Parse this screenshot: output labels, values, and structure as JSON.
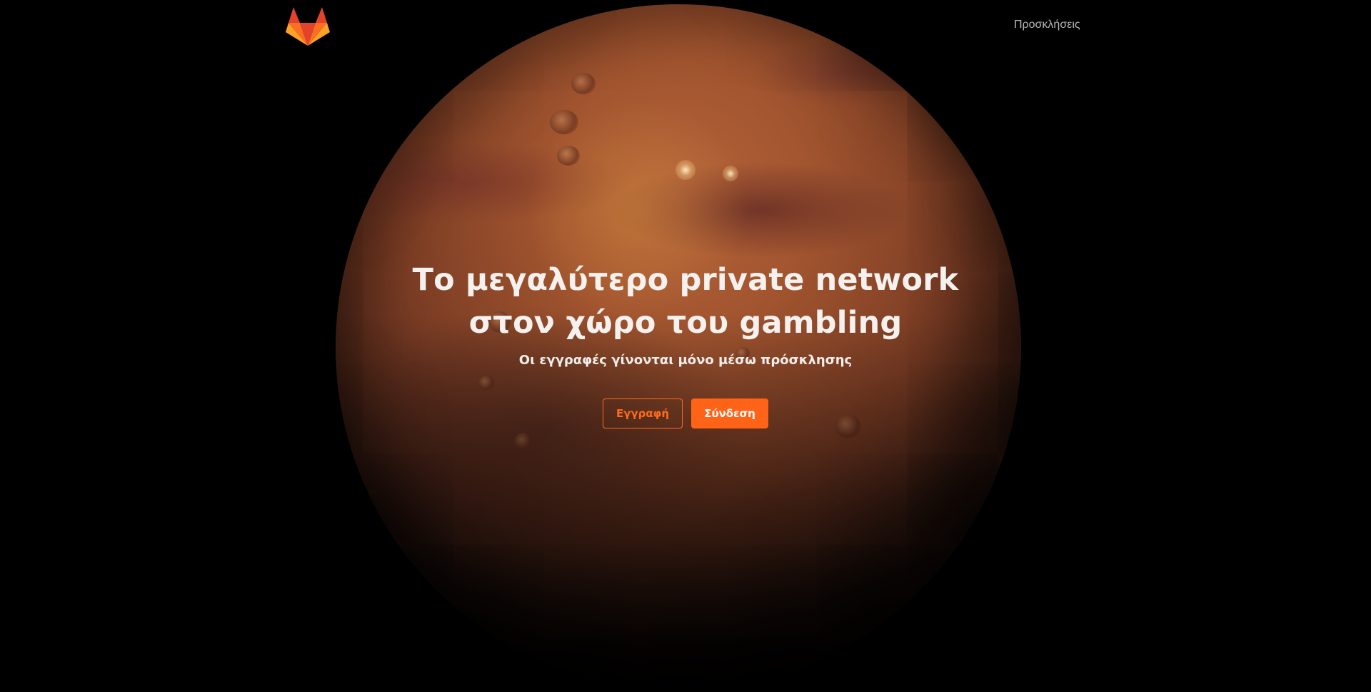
{
  "header": {
    "logo_icon": "gitlab-fox-logo",
    "nav_link": "Προσκλήσεις"
  },
  "hero": {
    "title_line1": "Το μεγαλύτερο private network",
    "title_line2": "στον χώρο του gambling",
    "subtitle": "Οι εγγραφές γίνονται μόνο μέσω πρόσκλησης"
  },
  "actions": {
    "register_label": "Εγγραφή",
    "login_label": "Σύνδεση"
  },
  "colors": {
    "accent": "#ff6318",
    "background": "#000000",
    "text": "#f4f1ef",
    "nav_text": "#b5b5b5"
  },
  "background_image": "mars-planet"
}
